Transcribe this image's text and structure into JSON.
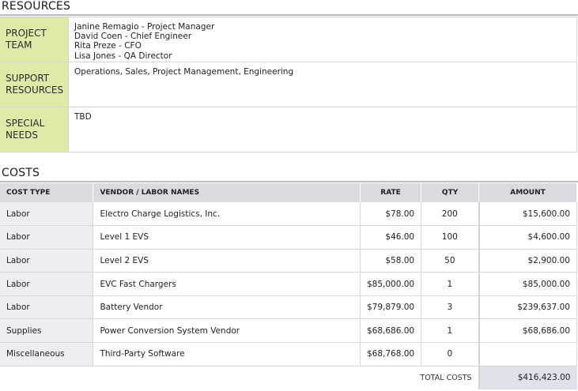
{
  "resources": {
    "title": "RESOURCES",
    "rows": [
      {
        "label": "PROJECT\nTEAM",
        "value": "Janine Remagio - Project Manager\nDavid Coen - Chief Engineer\nRita Preze - CFO\nLisa Jones - QA Director"
      },
      {
        "label": "SUPPORT\nRESOURCES",
        "value": "Operations, Sales, Project Management, Engineering"
      },
      {
        "label": "SPECIAL\nNEEDS",
        "value": "TBD"
      }
    ]
  },
  "costs": {
    "title": "COSTS",
    "headers": {
      "cost_type": "COST TYPE",
      "vendor": "VENDOR / LABOR NAMES",
      "rate": "RATE",
      "qty": "QTY",
      "amount": "AMOUNT"
    },
    "rows": [
      {
        "type": "Labor",
        "vendor": "Electro Charge Logistics, Inc.",
        "rate": "$78.00",
        "qty": "200",
        "amount": "$15,600.00"
      },
      {
        "type": "Labor",
        "vendor": "Level 1 EVS",
        "rate": "$46.00",
        "qty": "100",
        "amount": "$4,600.00"
      },
      {
        "type": "Labor",
        "vendor": "Level 2 EVS",
        "rate": "$58.00",
        "qty": "50",
        "amount": "$2,900.00"
      },
      {
        "type": "Labor",
        "vendor": "EVC Fast Chargers",
        "rate": "$85,000.00",
        "qty": "1",
        "amount": "$85,000.00"
      },
      {
        "type": "Labor",
        "vendor": "Battery Vendor",
        "rate": "$79,879.00",
        "qty": "3",
        "amount": "$239,637.00"
      },
      {
        "type": "Supplies",
        "vendor": "Power Conversion System Vendor",
        "rate": "$68,686.00",
        "qty": "1",
        "amount": "$68,686.00"
      },
      {
        "type": "Miscellaneous",
        "vendor": "Third-Party Software",
        "rate": "$68,768.00",
        "qty": "0",
        "amount": ""
      }
    ],
    "total_label": "TOTAL COSTS",
    "total_value": "$416,423.00"
  }
}
